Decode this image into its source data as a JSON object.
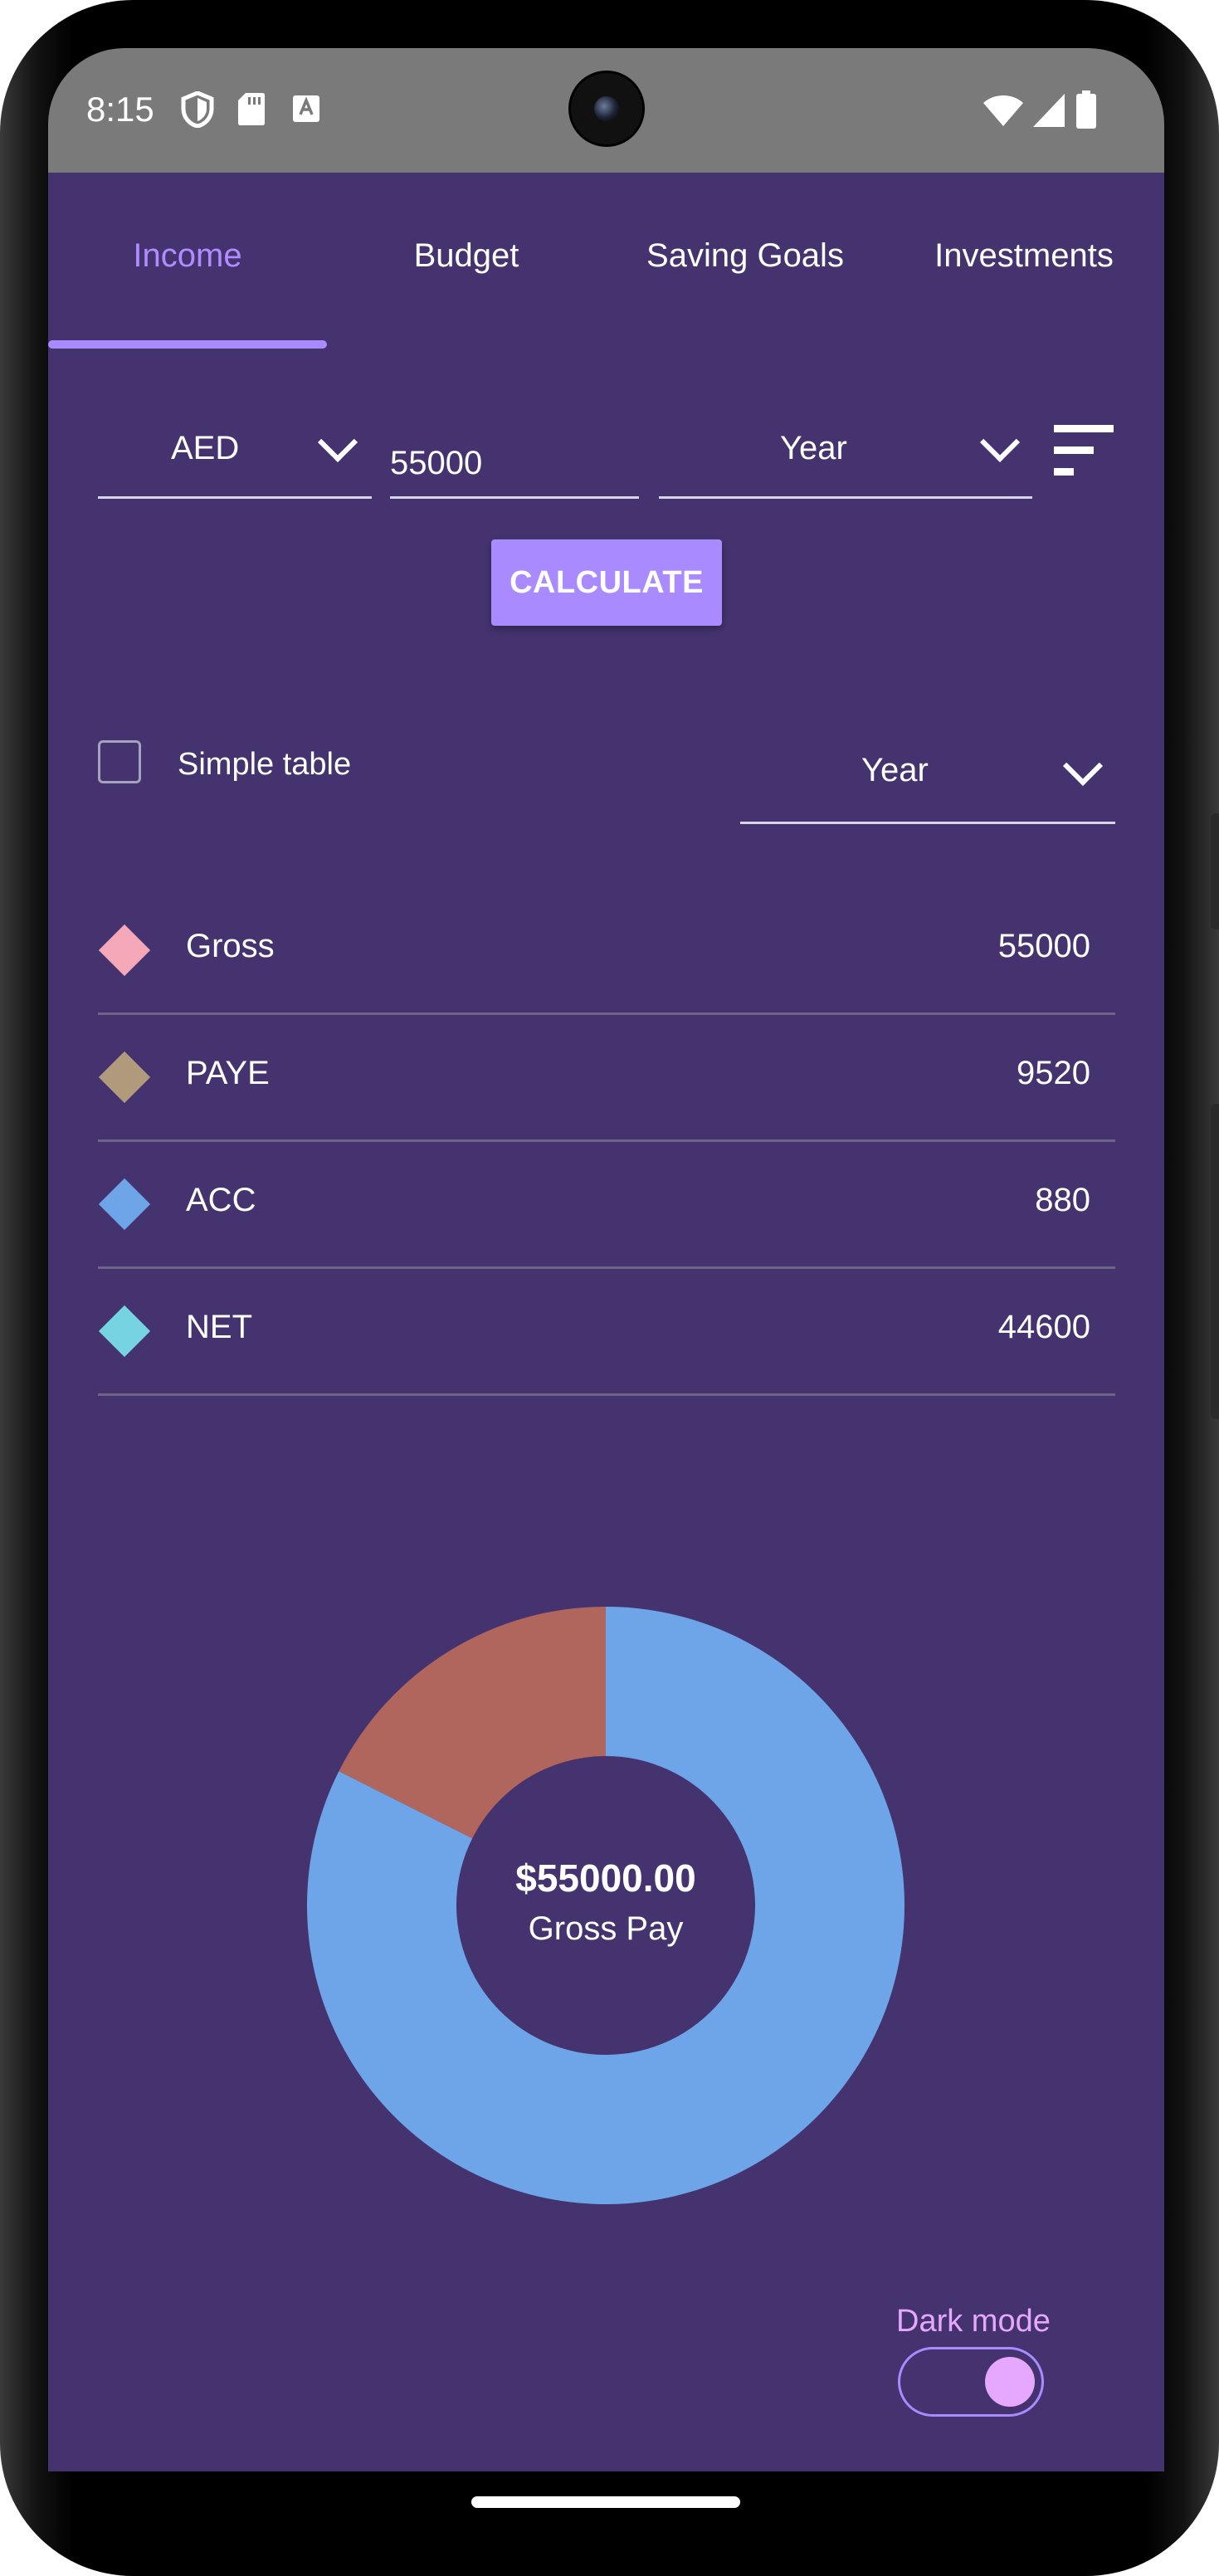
{
  "status_bar": {
    "time": "8:15",
    "icons_left": [
      "shield-icon",
      "sd-card-icon",
      "font-a-icon"
    ],
    "icons_right": [
      "wifi-icon",
      "cell-signal-icon",
      "battery-icon"
    ]
  },
  "tabs": [
    {
      "label": "Income",
      "active": true
    },
    {
      "label": "Budget",
      "active": false
    },
    {
      "label": "Saving Goals",
      "active": false
    },
    {
      "label": "Investments",
      "active": false
    }
  ],
  "inputs": {
    "currency": "AED",
    "amount": "55000",
    "period": "Year"
  },
  "calculate_label": "CALCULATE",
  "table_options": {
    "simple_table_label": "Simple table",
    "simple_table_checked": false,
    "period": "Year"
  },
  "breakdown": [
    {
      "label": "Gross",
      "value": "55000",
      "color": "#f4a8b8"
    },
    {
      "label": "PAYE",
      "value": "9520",
      "color": "#b09a7c"
    },
    {
      "label": "ACC",
      "value": "880",
      "color": "#6ea5e8"
    },
    {
      "label": "NET",
      "value": "44600",
      "color": "#76d3e0"
    }
  ],
  "donut": {
    "amount": "$55000.00",
    "caption": "Gross Pay",
    "segments": [
      {
        "name": "PAYE",
        "value": 9520,
        "color": "#b0665c"
      },
      {
        "name": "NET",
        "value": 44600,
        "color": "#6ea5e8"
      }
    ]
  },
  "dark_mode": {
    "label": "Dark mode",
    "enabled": true
  },
  "colors": {
    "background": "#44336f",
    "accent": "#a98aff",
    "dark_mode_accent": "#e6a8ff"
  }
}
